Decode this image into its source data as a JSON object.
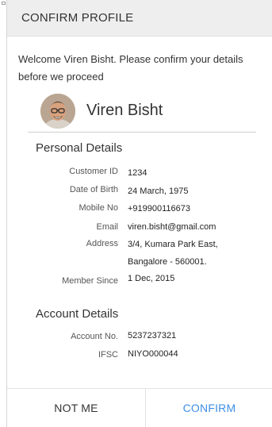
{
  "dialog": {
    "title": "CONFIRM PROFILE",
    "welcome": "Welcome Viren Bisht. Please confirm your details before we proceed"
  },
  "profile": {
    "name": "Viren Bisht",
    "avatar_icon": "user-photo-icon"
  },
  "personal_details": {
    "title": "Personal Details",
    "customer_id_label": "Customer ID",
    "customer_id": "1234",
    "dob_label": "Date of Birth",
    "dob": "24 March, 1975",
    "mobile_label": "Mobile No",
    "mobile": "+919900116673",
    "email_label": "Email",
    "email": "viren.bisht@gmail.com",
    "address_label": "Address",
    "address_line1": "3/4, Kumara Park East,",
    "address_line2": "Bangalore - 560001.",
    "member_since_label": "Member Since",
    "member_since": "1 Dec, 2015"
  },
  "account_details": {
    "title": "Account Details",
    "account_no_label": "Account No.",
    "account_no": "5237237321",
    "ifsc_label": "IFSC",
    "ifsc": "NIYO000044"
  },
  "actions": {
    "not_me": "NOT ME",
    "confirm": "CONFIRM"
  },
  "colors": {
    "header_bg": "#eeeeee",
    "confirm_accent": "#3d8ee5",
    "text": "#333333"
  }
}
